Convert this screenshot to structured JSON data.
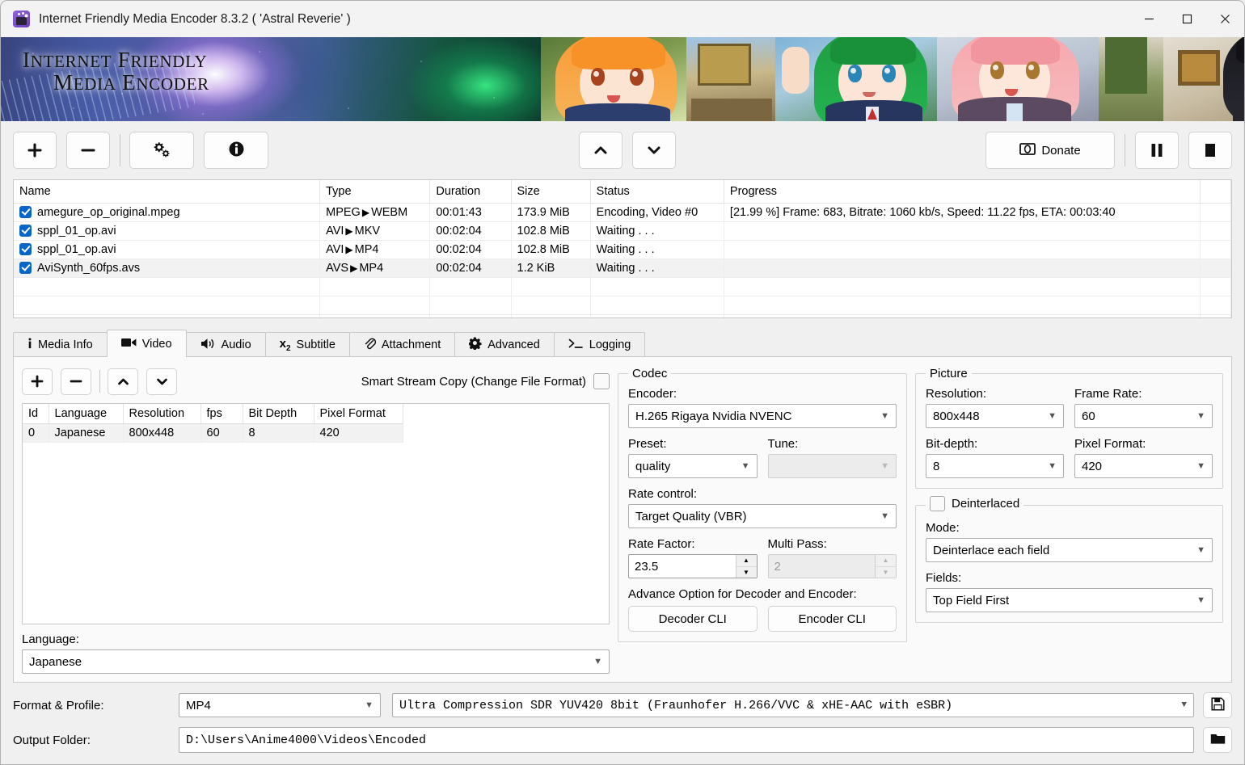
{
  "window": {
    "title": "Internet Friendly Media Encoder 8.3.2 ( 'Astral Reverie' )",
    "minimize_label": "Minimize",
    "maximize_label": "Maximize",
    "close_label": "Close"
  },
  "banner": {
    "line1": "INTERNET FRIENDLY",
    "line2": "MEDIA ENCODER"
  },
  "toolbar": {
    "add": "+",
    "remove": "−",
    "settings_icon": "gears-icon",
    "info_icon": "info-icon",
    "move_up": "∧",
    "move_down": "∨",
    "donate_label": "Donate",
    "pause_label": "Pause",
    "stop_label": "Stop"
  },
  "filelist": {
    "columns": [
      "Name",
      "Type",
      "Duration",
      "Size",
      "Status",
      "Progress"
    ],
    "rows": [
      {
        "checked": true,
        "name": "amegure_op_original.mpeg",
        "type_from": "MPEG",
        "type_to": "WEBM",
        "duration": "00:01:43",
        "size": "173.9 MiB",
        "status": "Encoding, Video #0",
        "progress": "[21.99 %] Frame: 683, Bitrate: 1060 kb/s, Speed: 11.22 fps, ETA: 00:03:40"
      },
      {
        "checked": true,
        "name": "sppl_01_op.avi",
        "type_from": "AVI",
        "type_to": "MKV",
        "duration": "00:02:04",
        "size": "102.8 MiB",
        "status": "Waiting . . .",
        "progress": ""
      },
      {
        "checked": true,
        "name": "sppl_01_op.avi",
        "type_from": "AVI",
        "type_to": "MP4",
        "duration": "00:02:04",
        "size": "102.8 MiB",
        "status": "Waiting . . .",
        "progress": ""
      },
      {
        "checked": true,
        "name": "AviSynth_60fps.avs",
        "type_from": "AVS",
        "type_to": "MP4",
        "duration": "00:02:04",
        "size": "1.2 KiB",
        "status": "Waiting . . .",
        "progress": ""
      }
    ]
  },
  "tabs": [
    {
      "label": "Media Info",
      "icon": "info-icon",
      "active": false
    },
    {
      "label": "Video",
      "icon": "video-camera-icon",
      "active": true
    },
    {
      "label": "Audio",
      "icon": "speaker-icon",
      "active": false
    },
    {
      "label": "Subtitle",
      "icon": "subscript-x2-icon",
      "active": false
    },
    {
      "label": "Attachment",
      "icon": "paperclip-icon",
      "active": false
    },
    {
      "label": "Advanced",
      "icon": "gear-icon",
      "active": false
    },
    {
      "label": "Logging",
      "icon": "terminal-prompt-icon",
      "active": false
    }
  ],
  "video": {
    "smart_stream_copy_label": "Smart Stream Copy (Change File Format)",
    "smart_stream_copy_checked": false,
    "stream_columns": [
      "Id",
      "Language",
      "Resolution",
      "fps",
      "Bit Depth",
      "Pixel Format"
    ],
    "stream_rows": [
      {
        "id": "0",
        "language": "Japanese",
        "resolution": "800x448",
        "fps": "60",
        "bit_depth": "8",
        "pixel_format": "420"
      }
    ],
    "language_label": "Language:",
    "language_value": "Japanese"
  },
  "codec": {
    "group_label": "Codec",
    "encoder_label": "Encoder:",
    "encoder_value": "H.265 Rigaya Nvidia NVENC",
    "preset_label": "Preset:",
    "preset_value": "quality",
    "tune_label": "Tune:",
    "tune_value": "",
    "tune_disabled": true,
    "rate_control_label": "Rate control:",
    "rate_control_value": "Target Quality (VBR)",
    "rate_factor_label": "Rate Factor:",
    "rate_factor_value": "23.5",
    "multi_pass_label": "Multi Pass:",
    "multi_pass_value": "2",
    "multi_pass_disabled": true,
    "advance_label": "Advance Option for Decoder and Encoder:",
    "decoder_cli_label": "Decoder CLI",
    "encoder_cli_label": "Encoder CLI"
  },
  "picture": {
    "group_label": "Picture",
    "resolution_label": "Resolution:",
    "resolution_value": "800x448",
    "frame_rate_label": "Frame Rate:",
    "frame_rate_value": "60",
    "bit_depth_label": "Bit-depth:",
    "bit_depth_value": "8",
    "pixel_format_label": "Pixel Format:",
    "pixel_format_value": "420"
  },
  "deinterlace": {
    "group_label": "Deinterlaced",
    "enabled": false,
    "mode_label": "Mode:",
    "mode_value": "Deinterlace each field",
    "fields_label": "Fields:",
    "fields_value": "Top Field First"
  },
  "bottom": {
    "format_label": "Format & Profile:",
    "format_value": "MP4",
    "profile_value": "Ultra Compression SDR YUV420 8bit (Fraunhofer H.266/VVC & xHE-AAC with eSBR)",
    "save_profile_icon": "floppy-disk-icon",
    "output_folder_label": "Output Folder:",
    "output_folder_value": "D:\\Users\\Anime4000\\Videos\\Encoded",
    "browse_icon": "folder-icon"
  },
  "colors": {
    "accent": "#0a65c8",
    "window_bg": "#f0f0f0",
    "pane_bg": "#fafafa"
  }
}
